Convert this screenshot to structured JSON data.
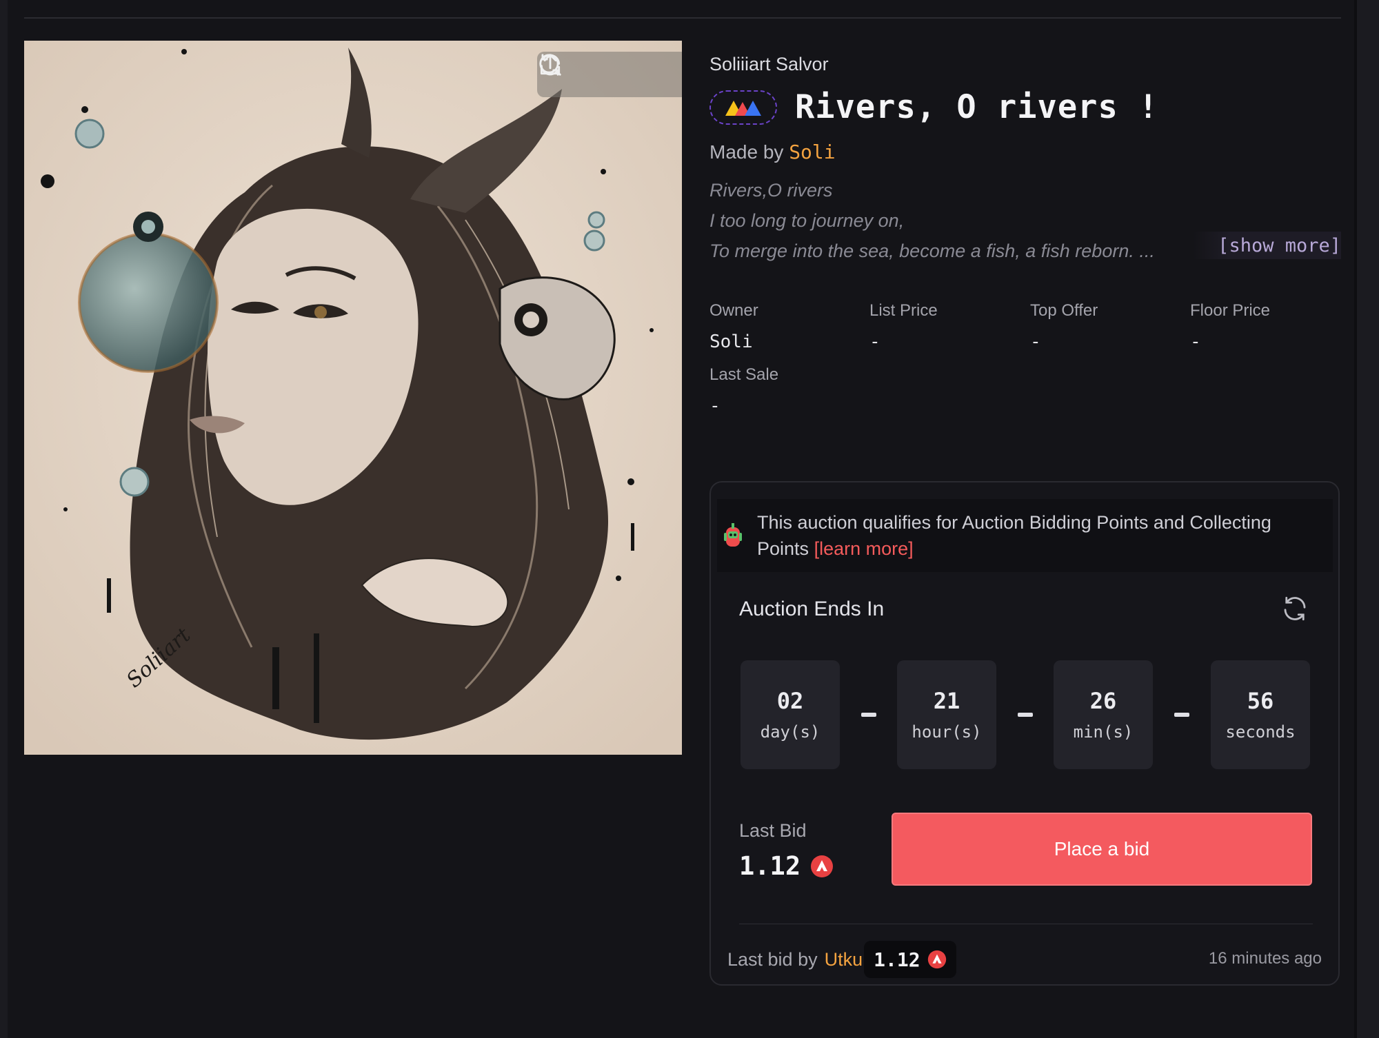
{
  "artwork": {
    "tools": [
      {
        "icon": "refresh-icon"
      },
      {
        "icon": "zoom-icon"
      },
      {
        "icon": "share-icon"
      }
    ],
    "signature": "Soliiart"
  },
  "nft": {
    "collection": "Soliiiart Salvor",
    "title": "Rivers, O rivers !",
    "made_by_prefix": "Made by",
    "creator": "Soli",
    "description_lines": [
      "Rivers,O rivers",
      "I too long to journey on,",
      "To merge into the sea, become a fish, a fish reborn. ..."
    ],
    "show_more": "[show more]"
  },
  "stats": [
    {
      "label": "Owner",
      "value": "Soli"
    },
    {
      "label": "List Price",
      "value": "-"
    },
    {
      "label": "Top Offer",
      "value": "-"
    },
    {
      "label": "Floor Price",
      "value": "-"
    },
    {
      "label": "Last Sale",
      "value": "-"
    }
  ],
  "auction": {
    "points_text": "This auction qualifies for Auction Bidding Points and Collecting Points",
    "learn_more": "[learn more]",
    "ends_label": "Auction Ends In",
    "countdown": [
      {
        "value": "02",
        "unit": "day(s)"
      },
      {
        "value": "21",
        "unit": "hour(s)"
      },
      {
        "value": "26",
        "unit": "min(s)"
      },
      {
        "value": "56",
        "unit": "seconds"
      }
    ],
    "last_bid_label": "Last Bid",
    "last_bid_value": "1.12",
    "place_bid": "Place a bid",
    "last_bid_by_prefix": "Last bid by",
    "last_bidder": "Utku",
    "last_bid_amount": "1.12",
    "last_bid_time": "16 minutes ago",
    "currency_icon": "avax-icon"
  },
  "colors": {
    "accent_red": "#f45a5f",
    "accent_orange": "#f4a340",
    "background": "#141418"
  }
}
